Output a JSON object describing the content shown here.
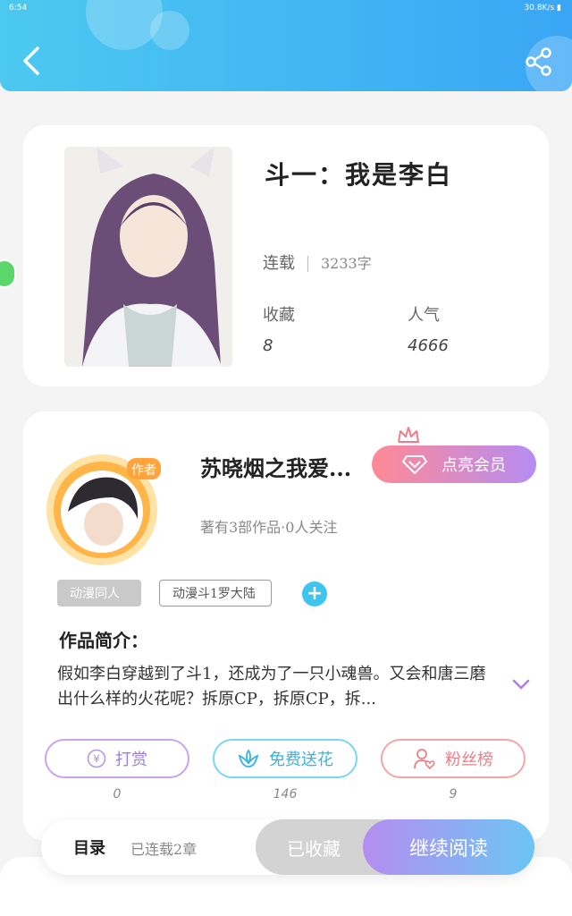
{
  "status_bar": {
    "time": "6:54",
    "speed": "30.8K/s"
  },
  "header": {
    "back_icon": "chevron-left-icon",
    "share_icon": "share-icon"
  },
  "book": {
    "title": "斗一：我是李白",
    "status": "连载",
    "word_count": "3233字",
    "collect_label": "收藏",
    "collect_value": "8",
    "popularity_label": "人气",
    "popularity_value": "4666"
  },
  "author": {
    "badge": "作者",
    "name": "苏晓烟之我爱...",
    "meta": "著有3部作品·0人关注",
    "vip_button": "点亮会员"
  },
  "tags": [
    "动漫同人",
    "动漫斗1罗大陆"
  ],
  "intro": {
    "label": "作品简介：",
    "text": "假如李白穿越到了斗1，还成为了一只小魂兽。又会和唐三磨出什么样的火花呢？拆原CP，拆原CP，拆..."
  },
  "actions": {
    "tip": {
      "label": "打赏",
      "count": "0"
    },
    "flower": {
      "label": "免费送花",
      "count": "146"
    },
    "fans": {
      "label": "粉丝榜",
      "count": "9"
    }
  },
  "bottom": {
    "menu": "目录",
    "chapters": "已连载2章",
    "collected": "已收藏",
    "read": "继续阅读"
  },
  "colors": {
    "header_start": "#4cc9f0",
    "header_end": "#3aa6f5",
    "vip_start": "#ff8a96",
    "vip_end": "#b58cf2",
    "read_start": "#b48ef0",
    "read_end": "#6cc5f3"
  }
}
